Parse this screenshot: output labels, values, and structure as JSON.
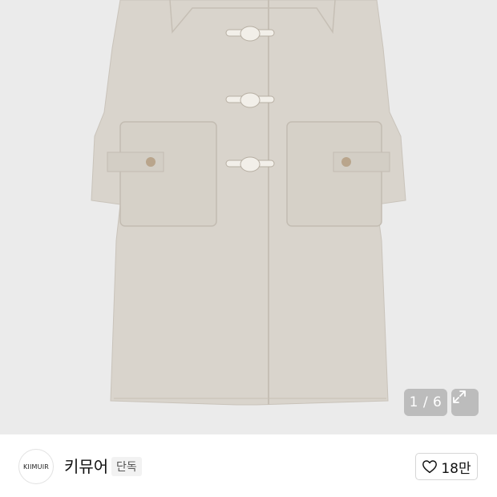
{
  "gallery": {
    "current": "1",
    "total": "6",
    "counter_text": "1 / 6",
    "expand_icon": "expand-arrows-icon"
  },
  "brand": {
    "logo_text": "KIIMUIR",
    "name": "키뮤어",
    "exclusive_label": "단독"
  },
  "like": {
    "icon": "heart-outline-icon",
    "count": "18만"
  },
  "colors": {
    "image_background": "#ebebeb",
    "coat": "#d9d4cc",
    "badge_background": "#969696"
  }
}
